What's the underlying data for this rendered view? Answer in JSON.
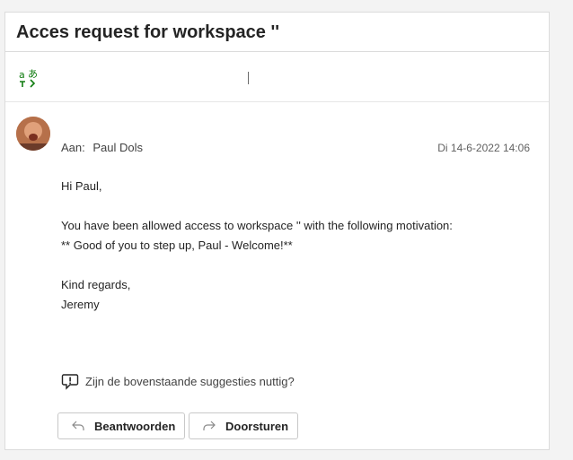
{
  "message": {
    "subject": "Acces request for workspace ''",
    "to_label": "Aan:",
    "to_name": "Paul Dols",
    "date": "Di 14-6-2022 14:06",
    "body_lines": [
      "Hi Paul,",
      "",
      "You have been allowed access to workspace '' with the following motivation:",
      "** Good of you to step up, Paul - Welcome!**",
      "",
      "Kind regards,",
      "Jeremy"
    ]
  },
  "feedback": {
    "question": "Zijn de bovenstaande suggesties nuttig?"
  },
  "actions": {
    "reply_label": "Beantwoorden",
    "forward_label": "Doorsturen"
  },
  "icons": {
    "translate": "translate-icon",
    "feedback": "feedback-icon",
    "reply": "reply-arrow-icon",
    "forward": "forward-arrow-icon"
  },
  "colors": {
    "translate_icon": "#107c10",
    "border": "#dcdcdc",
    "text": "#242424",
    "muted_text": "#616161"
  }
}
